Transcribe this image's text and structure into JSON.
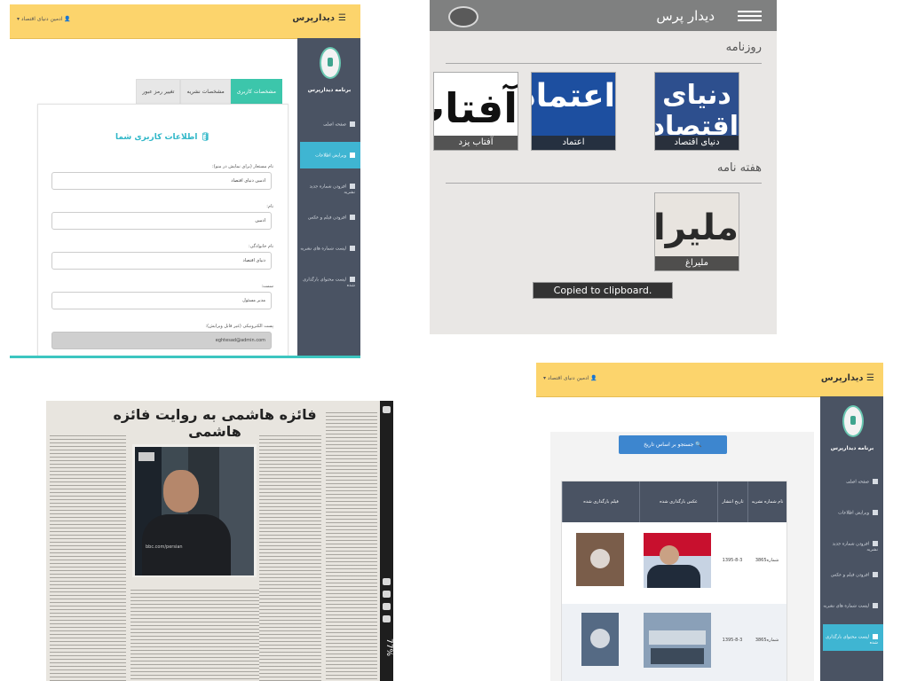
{
  "panel1": {
    "brand": "دیدارپرس",
    "user": "ادمین دنیای اقتصاد",
    "app_name": "برنامه دیدارپرس",
    "nav": [
      "صفحه اصلی",
      "ویرایش اطلاعات",
      "افزودن شماره جدید نشریه",
      "افزودن فیلم و عکس",
      "لیست شماره های نشریه",
      "لیست محتوای بارگذاری شده"
    ],
    "tabs": [
      "مشخصات کاربری",
      "مشخصات نشریه",
      "تغییر رمز عبور"
    ],
    "card_title": "اطلاعات کاربری شما",
    "fields": [
      {
        "label": "نام مستعار (برای نمایش در منو):",
        "value": "ادمین دنیای اقتصاد"
      },
      {
        "label": "نام:",
        "value": "ادمین"
      },
      {
        "label": "نام خانوادگی:",
        "value": "دنیای اقتصاد"
      },
      {
        "label": "سمت:",
        "value": "مدیر مسئول"
      },
      {
        "label": "پست الکترونیکی (غیر قابل ویرایش):",
        "value": "eghtesad@admin.com"
      }
    ]
  },
  "panel2": {
    "title": "دیدار پرس",
    "section_daily": "روزنامه",
    "section_weekly": "هفته نامه",
    "daily": [
      {
        "masthead": "دنیای اقتصاد",
        "caption": "دنیای اقتصاد",
        "bg": "#2d4f8e"
      },
      {
        "masthead": "اعتماد",
        "caption": "اعتماد",
        "bg": "#1d4fa0"
      },
      {
        "masthead": "آفتاب",
        "caption": "آفتاب یزد",
        "bg": "#ffffff"
      }
    ],
    "weekly": [
      {
        "masthead": "ملیراغ",
        "caption": "ملیراغ",
        "bg": "#e8e4df"
      }
    ],
    "toast": "Copied to clipboard."
  },
  "panel3": {
    "headline": "فائزه هاشمی به روایت فائزه هاشمی",
    "battery": "77%",
    "video_url": "bbc.com/persian"
  },
  "panel4": {
    "brand": "دیدارپرس",
    "user": "ادمین دنیای اقتصاد",
    "app_name": "برنامه دیدارپرس",
    "nav": [
      "صفحه اصلی",
      "ویرایش اطلاعات",
      "افزودن شماره جدید نشریه",
      "افزودن فیلم و عکس",
      "لیست شماره های نشریه",
      "لیست محتوای بارگذاری شده"
    ],
    "search_button": "جستجو بر اساس تاریخ",
    "columns": [
      "نام شماره نشریه",
      "تاریخ انتشار",
      "عکس بارگذاری شده",
      "فیلم بارگذاری شده"
    ],
    "rows": [
      {
        "issue": "شماره3865",
        "date": "1395-8-3"
      },
      {
        "issue": "شماره3865",
        "date": "1395-8-3"
      }
    ]
  },
  "colors": {
    "topbar": "#fcd46c",
    "sidebar": "#4a5363",
    "active": "#3fb5d2",
    "tab_active": "#3cc6ab",
    "button": "#3d86cf"
  }
}
